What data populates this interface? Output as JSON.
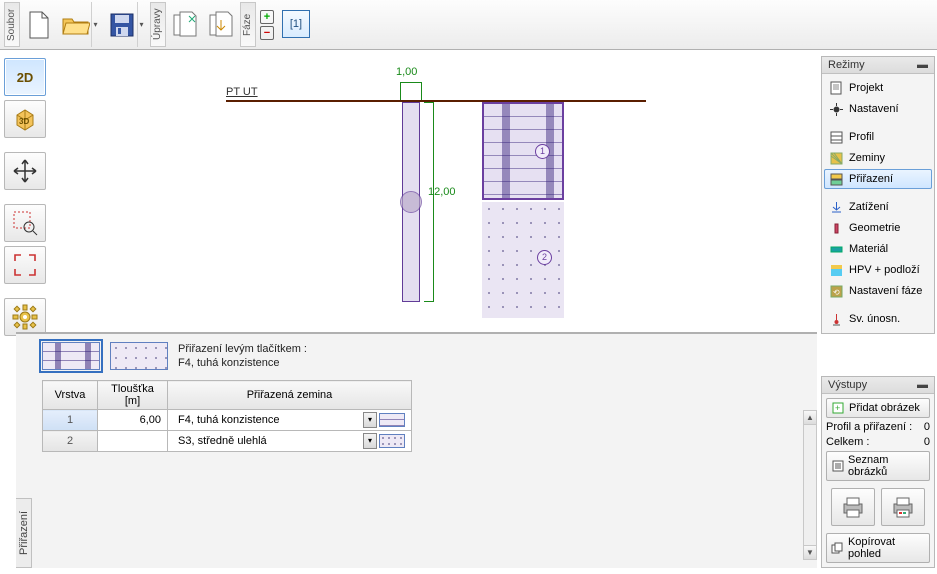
{
  "toolbar": {
    "group_file": "Soubor",
    "group_edit": "Úpravy",
    "group_phase": "Fáze",
    "phase_tab": "[1]"
  },
  "left_tools": {
    "btn_2d": "2D",
    "btn_3d": "3D"
  },
  "canvas": {
    "ptut": "PT UT",
    "dim_width": "1,00",
    "dim_height": "12,00",
    "layer1_mark": "1",
    "layer2_mark": "2"
  },
  "bottom": {
    "tab_label": "Přiřazení",
    "assign_line1": "Přiřazení levým tlačítkem :",
    "assign_line2": "F4, tuhá konzistence",
    "headers": {
      "layer": "Vrstva",
      "thickness": "Tloušťka [m]",
      "soil": "Přiřazená zemina"
    },
    "rows": [
      {
        "n": "1",
        "thk": "6,00",
        "soil": "F4, tuhá konzistence"
      },
      {
        "n": "2",
        "thk": "",
        "soil": "S3, středně ulehlá"
      }
    ]
  },
  "right": {
    "modes_title": "Režimy",
    "modes": {
      "projekt": "Projekt",
      "nastaveni": "Nastavení",
      "profil": "Profil",
      "zeminy": "Zeminy",
      "prirazeni": "Přiřazení",
      "zatizeni": "Zatížení",
      "geometrie": "Geometrie",
      "material": "Materiál",
      "hpv": "HPV + podloží",
      "nastaveni_faze": "Nastavení fáze",
      "sv_unosn": "Sv. únosn."
    },
    "outputs_title": "Výstupy",
    "add_image": "Přidat obrázek",
    "profile_assign": "Profil a přiřazení :",
    "profile_assign_count": "0",
    "total": "Celkem :",
    "total_count": "0",
    "image_list": "Seznam obrázků",
    "copy_view": "Kopírovat pohled"
  }
}
